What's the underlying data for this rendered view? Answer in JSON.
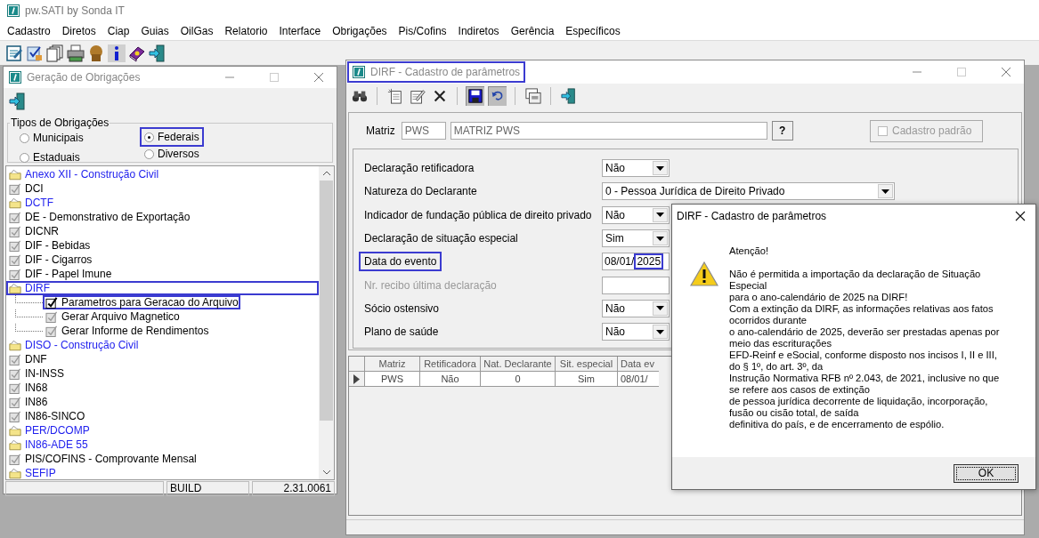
{
  "app": {
    "title": "pw.SATI by Sonda IT"
  },
  "menu": [
    "Cadastro",
    "Diretos",
    "Ciap",
    "Guias",
    "OilGas",
    "Relatorio",
    "Interface",
    "Obrigações",
    "Pis/Cofins",
    "Indiretos",
    "Gerência",
    "Específicos"
  ],
  "toolbar": [
    {
      "kind": "notepad"
    },
    {
      "kind": "checklist"
    },
    {
      "kind": "pages"
    },
    {
      "kind": "printer"
    },
    {
      "kind": "figure"
    },
    {
      "kind": "info"
    },
    {
      "kind": "book"
    },
    {
      "kind": "exit"
    }
  ],
  "obligations_window": {
    "title": "Geração de Obrigações",
    "group_label": "Tipos de Obrigações",
    "types": [
      {
        "label": "Municipais",
        "selected": false,
        "highlighted": false
      },
      {
        "label": "Federais",
        "selected": true,
        "highlighted": true
      },
      {
        "label": "Estaduais",
        "selected": false,
        "highlighted": false
      },
      {
        "label": "Diversos",
        "selected": false,
        "highlighted": false
      }
    ],
    "tree": [
      {
        "label": "Anexo XII - Construção Civil",
        "kind": "folder",
        "highlighted": false
      },
      {
        "label": "DCI",
        "kind": "item",
        "selected": false,
        "highlighted": false
      },
      {
        "label": "DCTF",
        "kind": "folder",
        "highlighted": false
      },
      {
        "label": "DE - Demonstrativo de Exportação",
        "kind": "item",
        "selected": false,
        "highlighted": false
      },
      {
        "label": "DICNR",
        "kind": "item",
        "selected": false,
        "highlighted": false
      },
      {
        "label": "DIF - Bebidas",
        "kind": "item",
        "selected": false,
        "highlighted": false
      },
      {
        "label": "DIF - Cigarros",
        "kind": "item",
        "selected": false,
        "highlighted": false
      },
      {
        "label": "DIF - Papel Imune",
        "kind": "item",
        "selected": false,
        "highlighted": false
      },
      {
        "label": "DIRF",
        "kind": "folder",
        "highlighted": true,
        "children": [
          {
            "label": "Parametros para Geracao do Arquivo",
            "kind": "item",
            "selected": true,
            "highlighted": true
          },
          {
            "label": "Gerar Arquivo Magnetico",
            "kind": "item",
            "selected": false,
            "highlighted": false
          },
          {
            "label": "Gerar Informe de Rendimentos",
            "kind": "item",
            "selected": false,
            "highlighted": false
          }
        ]
      },
      {
        "label": "DISO - Construção Civil",
        "kind": "folder",
        "highlighted": false
      },
      {
        "label": "DNF",
        "kind": "item",
        "selected": false,
        "highlighted": false
      },
      {
        "label": "IN-INSS",
        "kind": "item",
        "selected": false,
        "highlighted": false
      },
      {
        "label": "IN68",
        "kind": "item",
        "selected": false,
        "highlighted": false
      },
      {
        "label": "IN86",
        "kind": "item",
        "selected": false,
        "highlighted": false
      },
      {
        "label": "IN86-SINCO",
        "kind": "item",
        "selected": false,
        "highlighted": false
      },
      {
        "label": "PER/DCOMP",
        "kind": "folder",
        "highlighted": false
      },
      {
        "label": "IN86-ADE 55",
        "kind": "folder",
        "highlighted": false
      },
      {
        "label": "PIS/COFINS - Comprovante Mensal",
        "kind": "item",
        "selected": false,
        "highlighted": false
      },
      {
        "label": "SEFIP",
        "kind": "folder",
        "highlighted": false
      }
    ],
    "status": [
      "BUILD",
      "2.31.0061"
    ]
  },
  "dirf_window": {
    "title": "DIRF - Cadastro de parâmetros",
    "title_highlighted": true,
    "toolbar": [
      {
        "kind": "binoculars",
        "pressed": false
      },
      {
        "kind": "separator"
      },
      {
        "kind": "new-document",
        "pressed": false
      },
      {
        "kind": "edit-document",
        "pressed": false
      },
      {
        "kind": "delete",
        "pressed": false
      },
      {
        "kind": "separator"
      },
      {
        "kind": "save",
        "pressed": true
      },
      {
        "kind": "undo",
        "pressed": true
      },
      {
        "kind": "separator"
      },
      {
        "kind": "report",
        "pressed": false
      },
      {
        "kind": "separator"
      },
      {
        "kind": "exit",
        "pressed": false
      }
    ],
    "matriz": {
      "label": "Matriz",
      "code": "PWS",
      "name": "MATRIZ PWS",
      "lookup": "?"
    },
    "default_checkbox": {
      "label": "Cadastro padrão",
      "checked": false,
      "disabled": true
    },
    "fields": [
      {
        "label": "Declaração retificadora",
        "kind": "select",
        "value": "Não",
        "wide": false,
        "disabled": false,
        "highlighted": false
      },
      {
        "label": "Natureza do Declarante",
        "kind": "select",
        "value": "0 - Pessoa Jurídica de Direito Privado",
        "wide": true,
        "disabled": false,
        "highlighted": false
      },
      {
        "label": "Indicador de fundação pública de direito privado",
        "kind": "select",
        "value": "Não",
        "wide": false,
        "disabled": false,
        "highlighted": false
      },
      {
        "label": "Declaração de situação especial",
        "kind": "select",
        "value": "Sim",
        "wide": false,
        "disabled": false,
        "highlighted": false
      },
      {
        "label": "Data do evento",
        "kind": "date",
        "value": "08/01/",
        "year": "2025",
        "year_highlighted": true,
        "disabled": false,
        "highlighted": true
      },
      {
        "label": "Nr. recibo última declaração",
        "kind": "text",
        "disabled": true,
        "highlighted": false
      },
      {
        "label": "Sócio ostensivo",
        "kind": "select",
        "value": "Não",
        "wide": false,
        "disabled": false,
        "highlighted": false
      },
      {
        "label": "Plano de saúde",
        "kind": "select",
        "value": "Não",
        "wide": false,
        "disabled": false,
        "highlighted": false
      }
    ],
    "grid": {
      "columns": [
        "Matriz",
        "Retificadora",
        "Nat. Declarante",
        "Sit. especial",
        "Data ev"
      ],
      "rows": [
        {
          "selected": true,
          "cells": [
            "PWS",
            "Não",
            "0",
            "Sim",
            "08/01/"
          ]
        }
      ]
    }
  },
  "dialog": {
    "title": "DIRF - Cadastro de parâmetros",
    "heading": "Atenção!",
    "message": "Não é permitida a importação da declaração de Situação\nEspecial\npara o ano-calendário de 2025 na DIRF!\nCom a extinção da DIRF, as informações relativas aos fatos\nocorridos durante\no ano-calendário de 2025, deverão ser prestadas apenas por\nmeio das escriturações\nEFD-Reinf e eSocial, conforme disposto nos incisos I, II e III,\ndo § 1º, do art. 3º, da\nInstrução Normativa RFB nº 2.043, de 2021, inclusive no que\nse refere aos casos de extinção\nde pessoa jurídica decorrente de liquidação, incorporação,\nfusão ou cisão total, de saída\ndefinitiva do país, e de encerramento de espólio.",
    "button": "OK"
  }
}
